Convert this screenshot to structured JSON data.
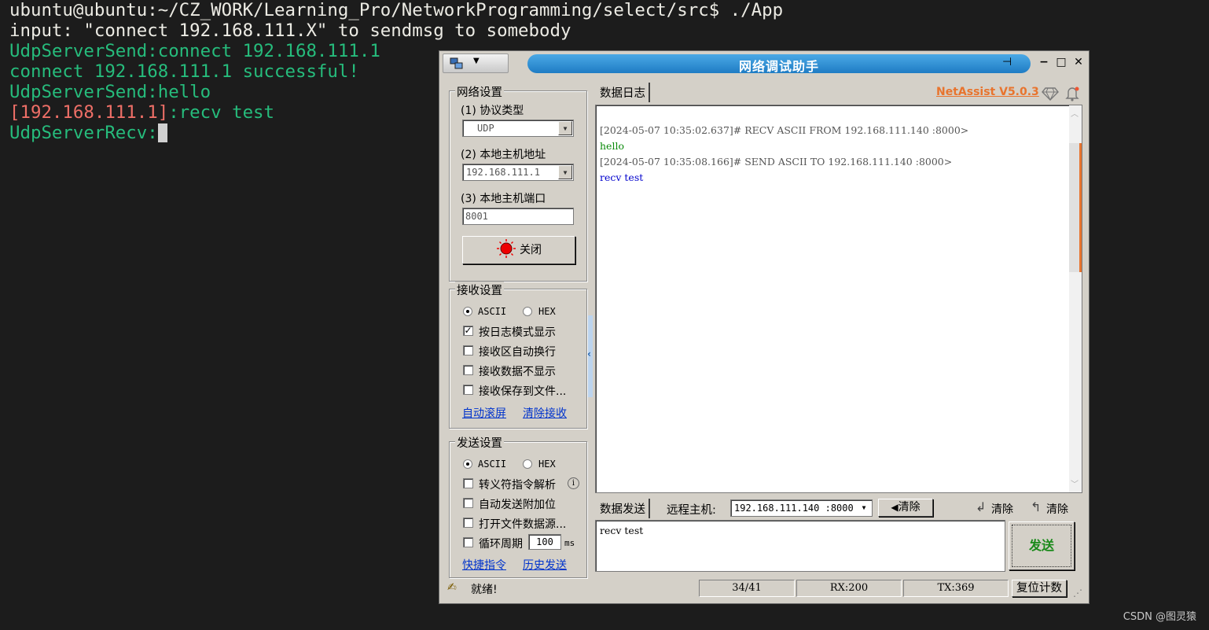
{
  "terminal": {
    "lines": [
      {
        "text": "ubuntu@ubuntu:~/CZ_WORK/Learning_Pro/NetworkProgramming/select/src$ ./App"
      },
      {
        "text": "input: \"connect 192.168.111.X\" to sendmsg to somebody"
      },
      {
        "text": "UdpServerSend:connect 192.168.111.1"
      },
      {
        "text": "connect 192.168.111.1 successful!"
      },
      {
        "text": "UdpServerSend:hello"
      },
      {
        "addr": "[192.168.111.1]",
        "msg": ":recv test"
      },
      {
        "text": "UdpServerRecv:"
      }
    ]
  },
  "app": {
    "title": "网络调试助手",
    "brand": "NetAssist V5.0.3",
    "window_buttons": [
      "−",
      "□",
      "✕"
    ],
    "network_settings": {
      "title": "网络设置",
      "protocol_label": "(1) 协议类型",
      "protocol_value": "UDP",
      "local_ip_label": "(2) 本地主机地址",
      "local_ip_value": "192.168.111.1",
      "local_port_label": "(3) 本地主机端口",
      "local_port_value": "8001",
      "close_button": "关闭"
    },
    "recv_settings": {
      "title": "接收设置",
      "ascii": "ASCII",
      "hex": "HEX",
      "opt1": "按日志模式显示",
      "opt2": "接收区自动换行",
      "opt3": "接收数据不显示",
      "opt4": "接收保存到文件...",
      "link1": "自动滚屏",
      "link2": "清除接收"
    },
    "send_settings": {
      "title": "发送设置",
      "ascii": "ASCII",
      "hex": "HEX",
      "opt1": "转义符指令解析",
      "opt2": "自动发送附加位",
      "opt3": "打开文件数据源...",
      "opt4": "循环周期",
      "period_value": "100",
      "period_unit": "ms",
      "link1": "快捷指令",
      "link2": "历史发送"
    },
    "log": {
      "tab": "数据日志",
      "lines": [
        {
          "text": "[2024-05-07 10:35:02.637]# RECV ASCII FROM 192.168.111.140 :8000>",
          "color": "#555555"
        },
        {
          "text": "hello",
          "color": "#0a8a0a"
        },
        {
          "text": "[2024-05-07 10:35:08.166]# SEND ASCII TO 192.168.111.140 :8000>",
          "color": "#555555"
        },
        {
          "text": "recv test",
          "color": "#0000cc"
        }
      ]
    },
    "send_bar": {
      "tab": "数据发送",
      "remote_label": "远程主机:",
      "remote_value": "192.168.111.140 :8000",
      "clear_button": "清除",
      "clear2": "清除",
      "clear3": "清除"
    },
    "send_text": "recv test",
    "send_button": "发送",
    "status": {
      "ready": "就绪!",
      "count": "34/41",
      "rx": "RX:200",
      "tx": "TX:369",
      "reset": "复位计数"
    }
  },
  "watermark": "CSDN @图灵猿",
  "colors": {
    "term_bg": "#1c1c1c",
    "term_green": "#26bc7c",
    "term_red": "#ee6f67",
    "title_blue": "#1f7cc4",
    "brand_orange": "#e8742e"
  }
}
